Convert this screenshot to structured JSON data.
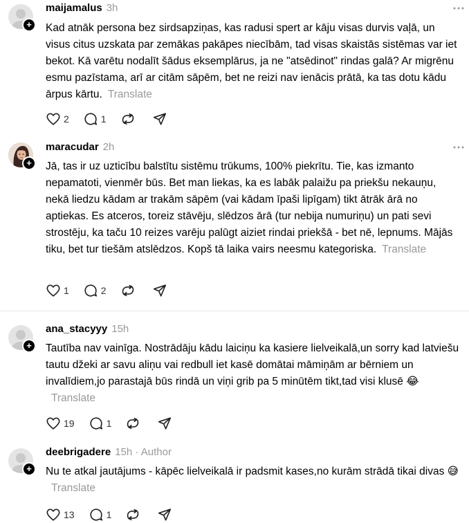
{
  "posts": [
    {
      "username": "maijamalus",
      "time": "3h",
      "author_tag": "",
      "text": "Kad atnāk persona bez sirdsapziņas, kas radusi spert ar kāju visas durvis vaļā, un visus citus uzskata par zemākas pakāpes niecībām, tad visas skaistās sistēmas var iet bekot. Kā varētu nodalīt šādus eksemplārus, ja ne \"atsēdinot\" rindas galā? Ar migrēnu esmu pazīstama, arī ar citām sāpēm, bet ne reizi nav ienācis prātā, ka tas dotu kādu ārpus kārtu.",
      "translate": "Translate",
      "likes": "2",
      "replies": "1",
      "reposts": "",
      "avatar": "default-avatar-icon"
    },
    {
      "username": "maracudar",
      "time": "2h",
      "author_tag": "",
      "text": "Jā, tas ir uz uzticību balstītu sistēmu trūkums, 100% piekrītu. Tie, kas izmanto nepamatoti, vienmēr būs. Bet man liekas, ka es labāk palaižu pa priekšu nekauņu, nekā liedzu kādam ar trakām sāpēm (vai kādam īpaši lipīgam) tikt ātrāk ārā no aptiekas. Es atceros, toreiz stāvēju, slēdzos ārā (tur nebija numuriņu) un pati sevi strostēju, ka taču 10 reizes varēju palūgt aiziet rindai priekšā - bet nē, lepnums. Mājās tiku, bet tur tiešām atslēdzos. Kopš tā laika vairs neesmu kategoriska.",
      "translate": "Translate",
      "likes": "1",
      "replies": "2",
      "reposts": "",
      "avatar": "photo-avatar-icon"
    },
    {
      "username": "ana_stacyyy",
      "time": "15h",
      "author_tag": "",
      "text": "Tautība nav vainīga. Nostrādāju kādu laiciņu ka kasiere lielveikalā,un sorry kad latviešu tautu džeki ar savu aliņu vai redbull iet kasē domātai māmiņām ar bērniem un invalīdiem,jo parastajā būs rindā un viņi grib pa 5 minūtēm tikt,tad visi klusē 😂",
      "translate": "Translate",
      "likes": "19",
      "replies": "1",
      "reposts": "",
      "avatar": "default-avatar-icon"
    },
    {
      "username": "deebrigadere",
      "time": "15h",
      "author_tag": "· Author",
      "text": "Nu te atkal jautājums - kāpēc lielveikalā ir padsmit kases,no kurām strādā tikai divas 😅",
      "translate": "Translate",
      "likes": "13",
      "replies": "1",
      "reposts": "",
      "avatar": "default-avatar-icon"
    }
  ]
}
